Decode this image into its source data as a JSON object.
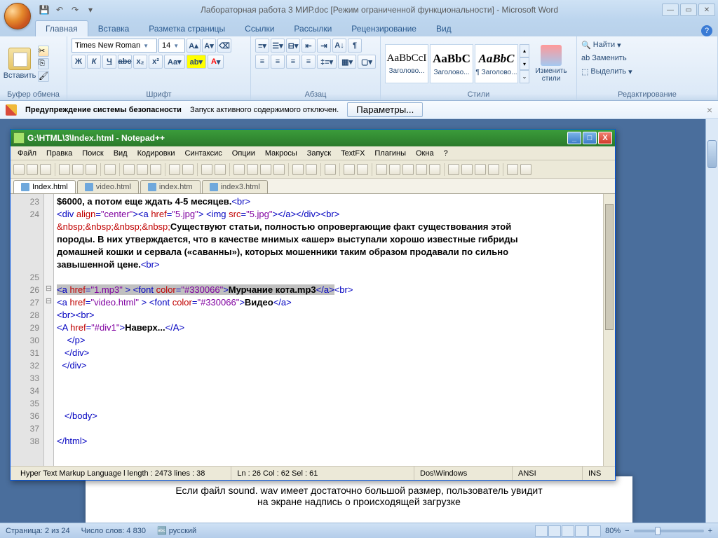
{
  "word": {
    "title": "Лабораторная работа 3 МИР.doc [Режим ограниченной функциональности] - Microsoft Word",
    "tabs": [
      "Главная",
      "Вставка",
      "Разметка страницы",
      "Ссылки",
      "Рассылки",
      "Рецензирование",
      "Вид"
    ],
    "active_tab": 0,
    "clipboard": {
      "paste": "Вставить",
      "label": "Буфер обмена"
    },
    "font": {
      "name": "Times New Roman",
      "size": "14",
      "label": "Шрифт"
    },
    "paragraph": {
      "label": "Абзац"
    },
    "styles": {
      "label": "Стили",
      "items": [
        {
          "preview": "AaBbCcI",
          "name": "Заголово..."
        },
        {
          "preview": "AaBbC",
          "name": "Заголово..."
        },
        {
          "preview": "AaBbC",
          "name": "¶ Заголово..."
        }
      ],
      "change": "Изменить стили"
    },
    "editing": {
      "label": "Редактирование",
      "find": "Найти",
      "replace": "Заменить",
      "select": "Выделить"
    },
    "security": {
      "warn": "Предупреждение системы безопасности",
      "msg": "Запуск активного содержимого отключен.",
      "btn": "Параметры..."
    },
    "doc_text1": "Если файл sound. wav имеет достаточно большой размер, пользователь увидит",
    "doc_text2": "на экране надпись о происходящей загрузке",
    "status": {
      "page": "Страница: 2 из 24",
      "words": "Число слов: 4 830",
      "lang": "русский",
      "zoom": "80%"
    }
  },
  "npp": {
    "title": "G:\\HTML\\3\\Index.html - Notepad++",
    "menu": [
      "Файл",
      "Правка",
      "Поиск",
      "Вид",
      "Кодировки",
      "Синтаксис",
      "Опции",
      "Макросы",
      "Запуск",
      "TextFX",
      "Плагины",
      "Окна",
      "?"
    ],
    "tabs": [
      {
        "name": "Index.html",
        "active": true
      },
      {
        "name": "video.html",
        "active": false
      },
      {
        "name": "index.htm",
        "active": false
      },
      {
        "name": "index3.html",
        "active": false
      }
    ],
    "first_line": 23,
    "code_lines": [
      {
        "n": 23,
        "html": "<span class='c-txt'>$6000, а потом еще ждать 4-5 месяцев.</span><span class='c-tag'>&lt;br&gt;</span>"
      },
      {
        "n": 24,
        "html": "<span class='c-tag'>&lt;div</span> <span class='c-attr'>align</span><span class='c-tag'>=</span><span class='c-str'>\"center\"</span><span class='c-tag'>&gt;&lt;a</span> <span class='c-attr'>href</span><span class='c-tag'>=</span><span class='c-str'>\"5.jpg\"</span><span class='c-tag'>&gt;</span> <span class='c-tag'>&lt;img</span> <span class='c-attr'>src</span><span class='c-tag'>=</span><span class='c-str'>\"5.jpg\"</span><span class='c-tag'>&gt;&lt;/a&gt;&lt;/div&gt;&lt;br&gt;</span>"
      },
      {
        "n": 0,
        "html": "<span class='c-attr'>&amp;nbsp;&amp;nbsp;&amp;nbsp;&amp;nbsp;</span><span class='c-txt'>Существуют статьи, полностью опровергающие факт существования этой</span>"
      },
      {
        "n": 0,
        "html": "<span class='c-txt'>породы. В них утверждается, что в качестве мнимых «ашер» выступали хорошо известные гибриды</span>"
      },
      {
        "n": 0,
        "html": "<span class='c-txt'>домашней кошки и сервала («саванны»), которых мошенники таким образом продавали по сильно</span>"
      },
      {
        "n": 0,
        "html": "<span class='c-txt'>завышенной цене.</span><span class='c-tag'>&lt;br&gt;</span>"
      },
      {
        "n": 25,
        "html": ""
      },
      {
        "n": 26,
        "fold": true,
        "html": "<span class='sel'><span class='c-tag'>&lt;a</span> <span class='c-attr'>href</span><span class='c-tag'>=</span><span class='c-str'>\"1.mp3\"</span> <span class='c-tag'>&gt;</span> <span class='c-tag'>&lt;font</span> <span class='c-attr'>color</span><span class='c-tag'>=</span><span class='c-str'>\"#330066\"</span><span class='c-tag'>&gt;</span><span class='c-txt'>Мурчание кота.mp3</span><span class='c-tag'>&lt;/a&gt;</span></span><span class='c-tag'>&lt;br&gt;</span>"
      },
      {
        "n": 27,
        "fold": true,
        "html": "<span class='c-tag'>&lt;a</span> <span class='c-attr'>href</span><span class='c-tag'>=</span><span class='c-str'>\"video.html\"</span> <span class='c-tag'>&gt;</span> <span class='c-tag'>&lt;font</span> <span class='c-attr'>color</span><span class='c-tag'>=</span><span class='c-str'>\"#330066\"</span><span class='c-tag'>&gt;</span><span class='c-txt'>Видео</span><span class='c-tag'>&lt;/a&gt;</span>"
      },
      {
        "n": 28,
        "html": "<span class='c-tag'>&lt;br&gt;&lt;br&gt;</span>"
      },
      {
        "n": 29,
        "html": "<span class='c-tag'>&lt;A</span> <span class='c-attr'>href</span><span class='c-tag'>=</span><span class='c-str'>\"#div1\"</span><span class='c-tag'>&gt;</span><span class='c-txt'>Наверх...</span><span class='c-tag'>&lt;/A&gt;</span>"
      },
      {
        "n": 30,
        "html": "    <span class='c-tag'>&lt;/p&gt;</span>"
      },
      {
        "n": 31,
        "html": "   <span class='c-tag'>&lt;/div&gt;</span>"
      },
      {
        "n": 32,
        "html": "  <span class='c-tag'>&lt;/div&gt;</span>"
      },
      {
        "n": 33,
        "html": ""
      },
      {
        "n": 34,
        "html": ""
      },
      {
        "n": 35,
        "html": ""
      },
      {
        "n": 36,
        "html": "   <span class='c-tag'>&lt;/body&gt;</span>"
      },
      {
        "n": 37,
        "html": ""
      },
      {
        "n": 38,
        "html": "<span class='c-tag'>&lt;/html&gt;</span>"
      }
    ],
    "status": {
      "lang": "Hyper Text Markup Language l length : 2473    lines : 38",
      "pos": "Ln : 26   Col : 62   Sel : 61",
      "eol": "Dos\\Windows",
      "enc": "ANSI",
      "mode": "INS"
    }
  }
}
